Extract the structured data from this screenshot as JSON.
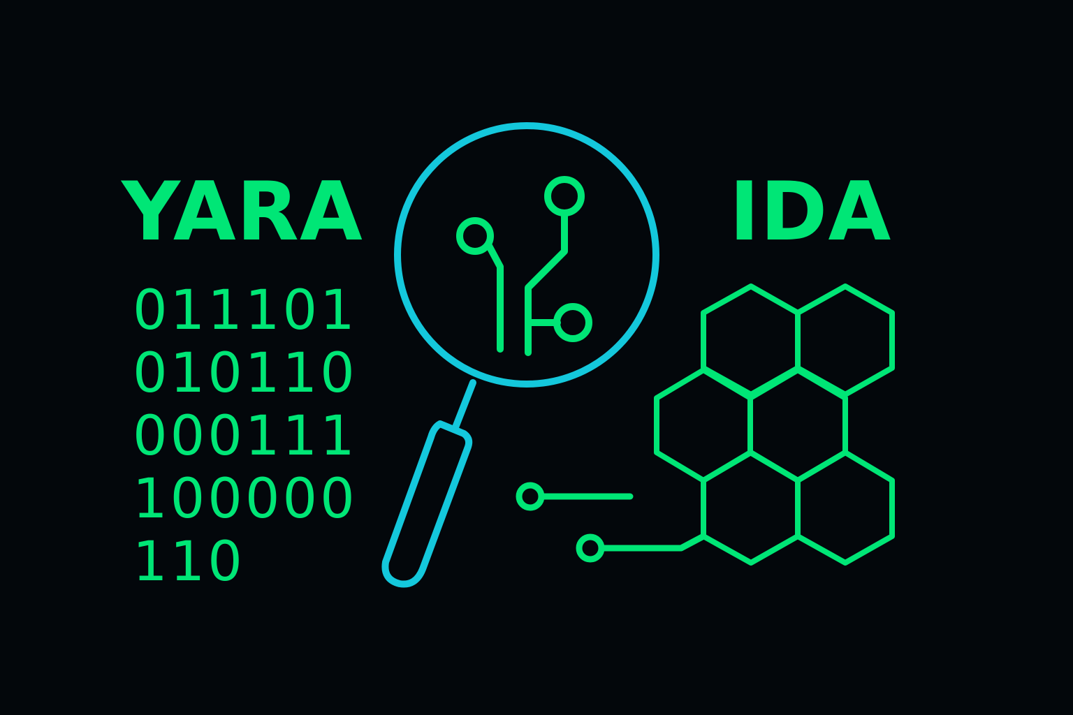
{
  "labels": {
    "left_title": "YARA",
    "right_title": "IDA"
  },
  "binary_lines": [
    "011101",
    "010110",
    "000111",
    "100000",
    "110"
  ],
  "colors": {
    "background": "#03070b",
    "green": "#00e676",
    "cyan": "#14c8dc"
  },
  "icons": {
    "magnifier": "magnifying-glass-icon",
    "circuit": "circuit-trace-icon",
    "honeycomb": "hexagon-grid-icon"
  }
}
